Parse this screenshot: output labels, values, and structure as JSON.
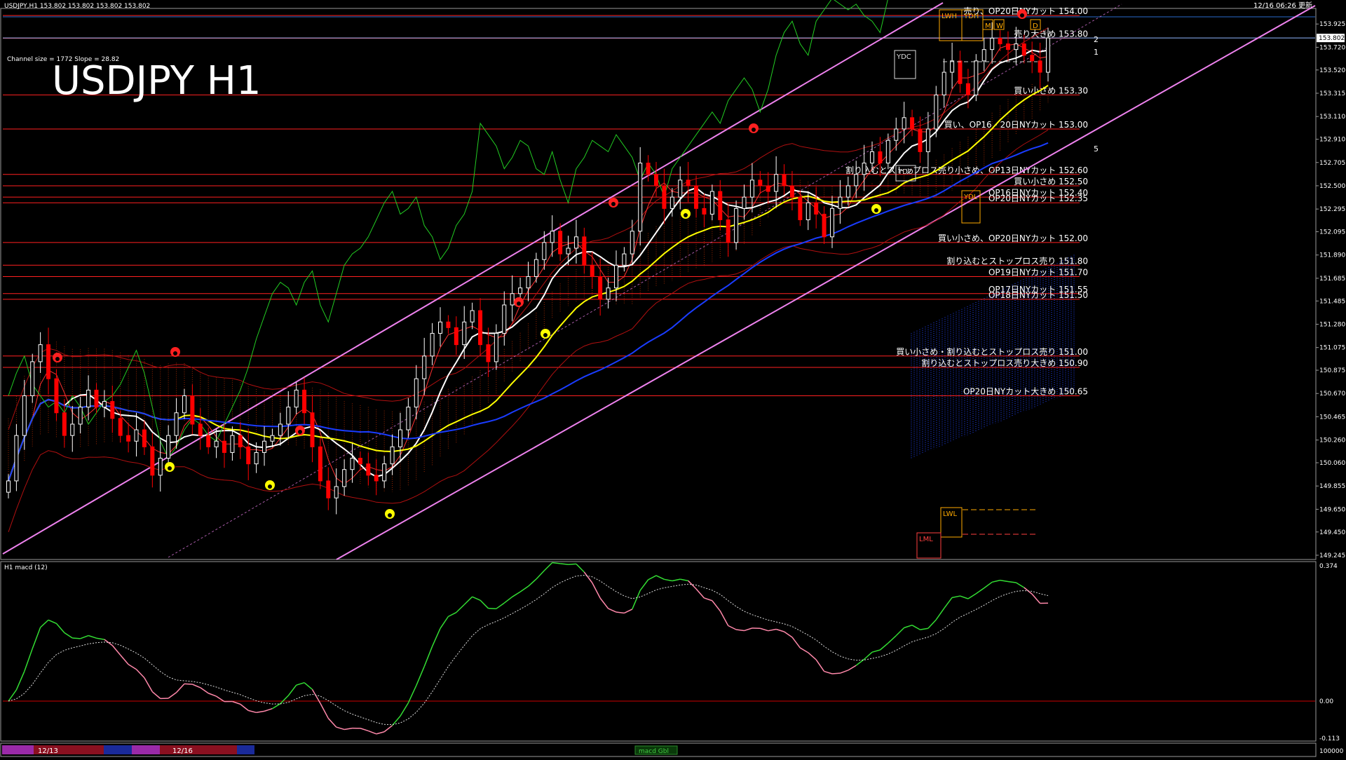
{
  "window": {
    "header_text": "USDJPY,H1  153.802 153.802 153.802 153.802",
    "updated_text": "12/16 06:26 更新",
    "channel_info": "Channel size = 1772 Slope = 28.82",
    "big_title": "USDJPY H1"
  },
  "price_axis": {
    "labels": [
      "153.925",
      "153.720",
      "153.520",
      "153.315",
      "153.110",
      "152.910",
      "152.705",
      "152.500",
      "152.295",
      "152.095",
      "151.890",
      "151.685",
      "151.485",
      "151.280",
      "151.075",
      "150.875",
      "150.670",
      "150.465",
      "150.260",
      "150.060",
      "149.855",
      "149.650",
      "149.450",
      "149.245"
    ],
    "current_price": "153.802",
    "min": 149.22,
    "max": 154.05
  },
  "macd_axis": {
    "top_label": "0.374",
    "zero_label": "0.00",
    "bottom_label": "-0.113"
  },
  "macd_panel": {
    "title": "H1  macd (12)"
  },
  "time_axis": {
    "labels": [
      "12/13",
      "12/16"
    ],
    "right_label": "100000",
    "macd_badge": "macd Gbl"
  },
  "levels": [
    {
      "label": "売り、OP20日NYカット 154.00",
      "price": 154.0
    },
    {
      "label": "売り大きめ 153.80",
      "price": 153.8
    },
    {
      "label": "買い小さめ 153.30",
      "price": 153.3
    },
    {
      "label": "買い、OP16・20日NYカット 153.00",
      "price": 153.0
    },
    {
      "label": "割り込むとストップロス売り小さめ、OP13日NYカット 152.60",
      "price": 152.6
    },
    {
      "label": "買い小さめ 152.50",
      "price": 152.5
    },
    {
      "label": "OP16日NYカット 152.40",
      "price": 152.4
    },
    {
      "label": "OP20日NYカット 152.35",
      "price": 152.35
    },
    {
      "label": "買い小さめ、OP20日NYカット 152.00",
      "price": 152.0
    },
    {
      "label": "割り込むとストップロス売り 151.80",
      "price": 151.8
    },
    {
      "label": "OP19日NYカット 151.70",
      "price": 151.7
    },
    {
      "label": "OP17日NYカット 151.55",
      "price": 151.55
    },
    {
      "label": "OP18日NYカット 151.50",
      "price": 151.5
    },
    {
      "label": "買い小さめ・割り込むとストップロス売り 151.00",
      "price": 151.0
    },
    {
      "label": "割り込むとストップロス売り大きめ 150.90",
      "price": 150.9
    },
    {
      "label": "OP20日NYカット大きめ 150.65",
      "price": 150.65
    }
  ],
  "markers": {
    "lwh": "LWH",
    "ydh": "YDH",
    "ydc": "YDC",
    "ydo": "YDO",
    "ydl": "YDL",
    "lwl": "LWL",
    "lml": "LML",
    "m": "M",
    "w": "W",
    "d": "D",
    "ch1": "1",
    "ch2": "2",
    "ch5": "5"
  },
  "colors": {
    "background": "#000000",
    "up_candle": "#ffffff",
    "down_candle": "#ff0000",
    "level_line": "#ff2020",
    "channel": "#ee82ee",
    "ma_fast": "#ffffff",
    "ma_mid": "#ffff00",
    "ma_slow": "#1a3cff",
    "chikou": "#22cc22",
    "kumo_bear": "#cc3300",
    "kumo_bull": "#2244ff",
    "macd_up": "#33dd33",
    "macd_down": "#ff88aa"
  },
  "chart_data": {
    "type": "candlestick",
    "symbol": "USDJPY",
    "timeframe": "H1",
    "ylim": [
      149.22,
      154.05
    ],
    "close": [
      149.9,
      150.3,
      150.65,
      150.95,
      151.1,
      150.8,
      150.5,
      150.3,
      150.4,
      150.55,
      150.7,
      150.55,
      150.6,
      150.45,
      150.3,
      150.25,
      150.35,
      150.2,
      149.95,
      150.1,
      150.3,
      150.5,
      150.65,
      150.4,
      150.3,
      150.2,
      150.25,
      150.15,
      150.3,
      150.2,
      150.05,
      150.15,
      150.25,
      150.3,
      150.4,
      150.55,
      150.7,
      150.5,
      150.2,
      149.9,
      149.75,
      149.85,
      150.0,
      150.1,
      150.05,
      149.95,
      149.9,
      150.05,
      150.2,
      150.35,
      150.55,
      150.8,
      151.0,
      151.2,
      151.3,
      151.25,
      151.1,
      151.3,
      151.4,
      151.1,
      150.95,
      151.2,
      151.45,
      151.55,
      151.6,
      151.7,
      151.85,
      152.0,
      152.1,
      151.9,
      151.95,
      152.05,
      151.8,
      151.7,
      151.5,
      151.6,
      151.8,
      151.9,
      152.1,
      152.7,
      152.6,
      152.5,
      152.3,
      152.4,
      152.55,
      152.5,
      152.3,
      152.25,
      152.45,
      152.2,
      152.0,
      152.3,
      152.4,
      152.55,
      152.5,
      152.45,
      152.6,
      152.5,
      152.4,
      152.2,
      152.35,
      152.25,
      152.05,
      152.3,
      152.4,
      152.5,
      152.6,
      152.7,
      152.8,
      152.7,
      152.9,
      153.0,
      153.1,
      153.0,
      152.8,
      153.0,
      153.3,
      153.5,
      153.6,
      153.4,
      153.3,
      153.6,
      153.7,
      153.8,
      153.75,
      153.7,
      153.75,
      153.65,
      153.6,
      153.5,
      153.802
    ]
  }
}
